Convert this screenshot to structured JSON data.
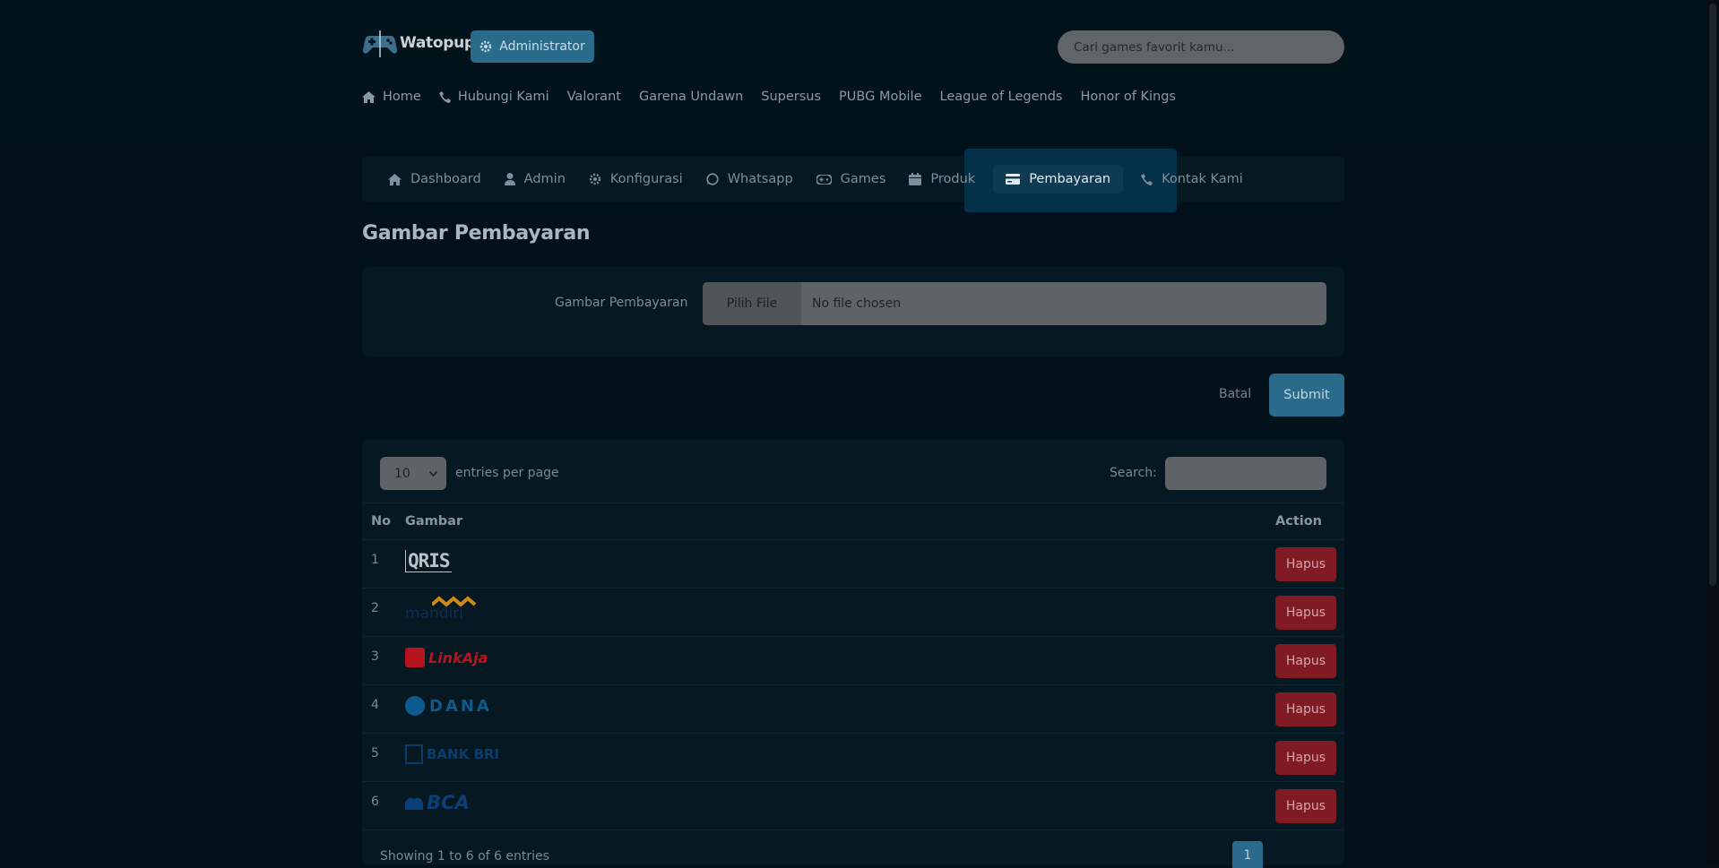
{
  "header": {
    "logo_text": "Watopup",
    "admin_button": "Administrator",
    "search_placeholder": "Cari games favorit kamu..."
  },
  "nav": {
    "items": [
      {
        "label": "Home",
        "icon": "home-icon"
      },
      {
        "label": "Hubungi Kami",
        "icon": "phone-icon"
      },
      {
        "label": "Valorant"
      },
      {
        "label": "Garena Undawn"
      },
      {
        "label": "Supersus"
      },
      {
        "label": "PUBG Mobile"
      },
      {
        "label": "League of Legends"
      },
      {
        "label": "Honor of Kings"
      }
    ]
  },
  "admin_nav": {
    "items": [
      {
        "label": "Dashboard",
        "icon": "home-icon"
      },
      {
        "label": "Admin",
        "icon": "user-icon"
      },
      {
        "label": "Konfigurasi",
        "icon": "gear-icon"
      },
      {
        "label": "Whatsapp",
        "icon": "whatsapp-icon"
      },
      {
        "label": "Games",
        "icon": "gamepad-icon"
      },
      {
        "label": "Produk",
        "icon": "box-icon"
      },
      {
        "label": "Pembayaran",
        "icon": "credit-card-icon",
        "active": true
      },
      {
        "label": "Kontak Kami",
        "icon": "phone-icon"
      }
    ]
  },
  "page": {
    "title": "Gambar Pembayaran"
  },
  "form": {
    "label": "Gambar Pembayaran",
    "file_button": "Pilih File",
    "file_status": "No file chosen",
    "cancel": "Batal",
    "submit": "Submit"
  },
  "table": {
    "page_size": "10",
    "entries_label": "entries per page",
    "search_label": "Search:",
    "headers": {
      "no": "No",
      "gambar": "Gambar",
      "action": "Action"
    },
    "rows": [
      {
        "no": "1",
        "logo": "QRIS",
        "action": "Hapus"
      },
      {
        "no": "2",
        "logo": "mandiri",
        "action": "Hapus"
      },
      {
        "no": "3",
        "logo": "LinkAja",
        "action": "Hapus"
      },
      {
        "no": "4",
        "logo": "DANA",
        "action": "Hapus"
      },
      {
        "no": "5",
        "logo": "BANK BRI",
        "action": "Hapus"
      },
      {
        "no": "6",
        "logo": "BCA",
        "action": "Hapus"
      }
    ],
    "showing": "Showing 1 to 6 of 6 entries",
    "current_page": "1"
  },
  "colors": {
    "accent": "#2a6a8a",
    "danger": "#801b24",
    "background": "#03111a",
    "card": "#061822"
  }
}
